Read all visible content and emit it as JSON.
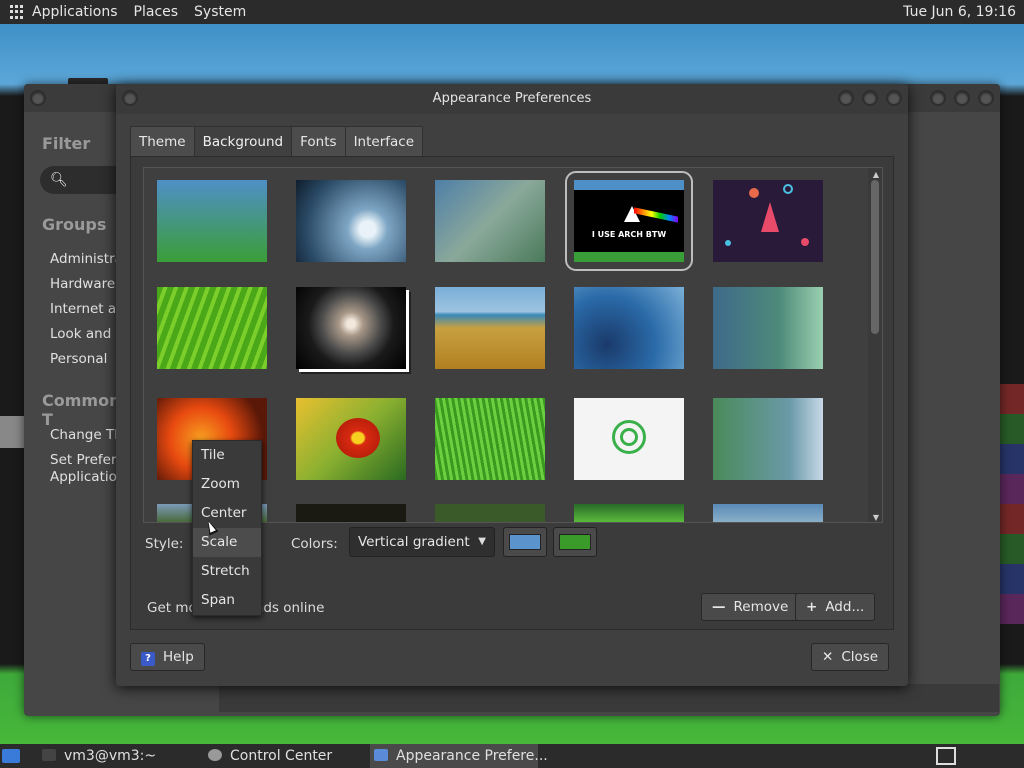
{
  "top_panel": {
    "menus": [
      "Applications",
      "Places",
      "System"
    ],
    "clock": "Tue Jun  6, 19:16"
  },
  "control_center": {
    "filter_heading": "Filter",
    "groups_heading": "Groups",
    "groups": [
      "Administra",
      "Hardware",
      "Internet an",
      "Look and F",
      "Personal"
    ],
    "common_heading": "Common T",
    "common_tasks": [
      "Change Th",
      "Set Preferre",
      "Application"
    ]
  },
  "dialog": {
    "title": "Appearance Preferences",
    "tabs": [
      "Theme",
      "Background",
      "Fonts",
      "Interface"
    ],
    "active_tab": "Background",
    "selected_thumb_text": "I USE ARCH BTW",
    "style_label": "Style:",
    "colors_label": "Colors:",
    "gradient": "Vertical gradient",
    "color1": "#5b93cc",
    "color2": "#3a9a2a",
    "get_more_left": "Get mo",
    "get_more_right": "nds online",
    "remove_label": "Remove",
    "add_label": "Add...",
    "help_label": "Help",
    "close_label": "Close"
  },
  "style_menu": {
    "options": [
      "Tile",
      "Zoom",
      "Center",
      "Scale",
      "Stretch",
      "Span"
    ],
    "highlighted": "Scale"
  },
  "taskbar": {
    "items": [
      "vm3@vm3:~",
      "Control Center",
      "Appearance Prefere..."
    ]
  }
}
